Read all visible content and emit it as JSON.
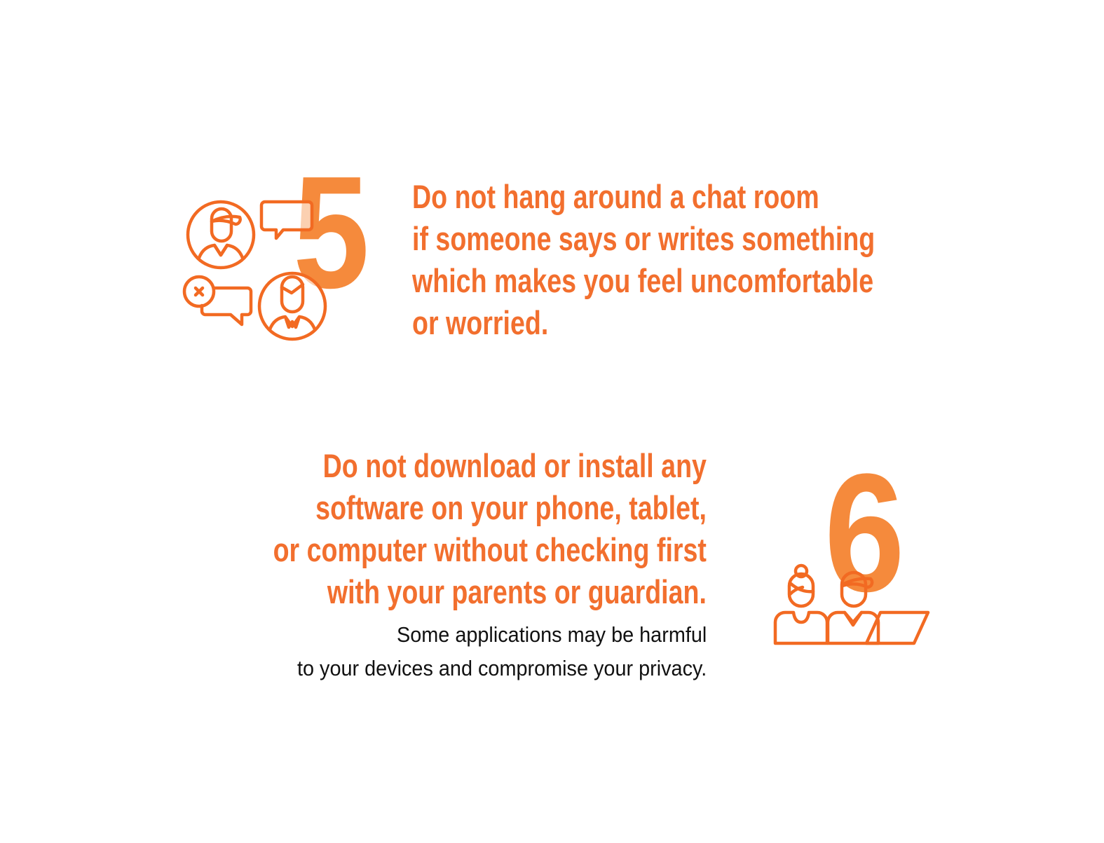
{
  "colors": {
    "text": "#f26f2e",
    "numeral": "#f58a3c",
    "icon": "#f26a22",
    "body_text": "#111111"
  },
  "tip5": {
    "number": "5",
    "icon": "chat-users-icon",
    "heading_lines": [
      "Do not hang around a chat room",
      "if someone says or writes something",
      "which makes you feel uncomfortable",
      "or worried."
    ]
  },
  "tip6": {
    "number": "6",
    "icon": "parents-laptop-icon",
    "heading_lines": [
      "Do not download or install any",
      "software on your phone, tablet,",
      "or computer without checking first",
      "with your parents or guardian."
    ],
    "body_lines": [
      "Some applications may be harmful",
      "to your devices and compromise your privacy."
    ]
  }
}
